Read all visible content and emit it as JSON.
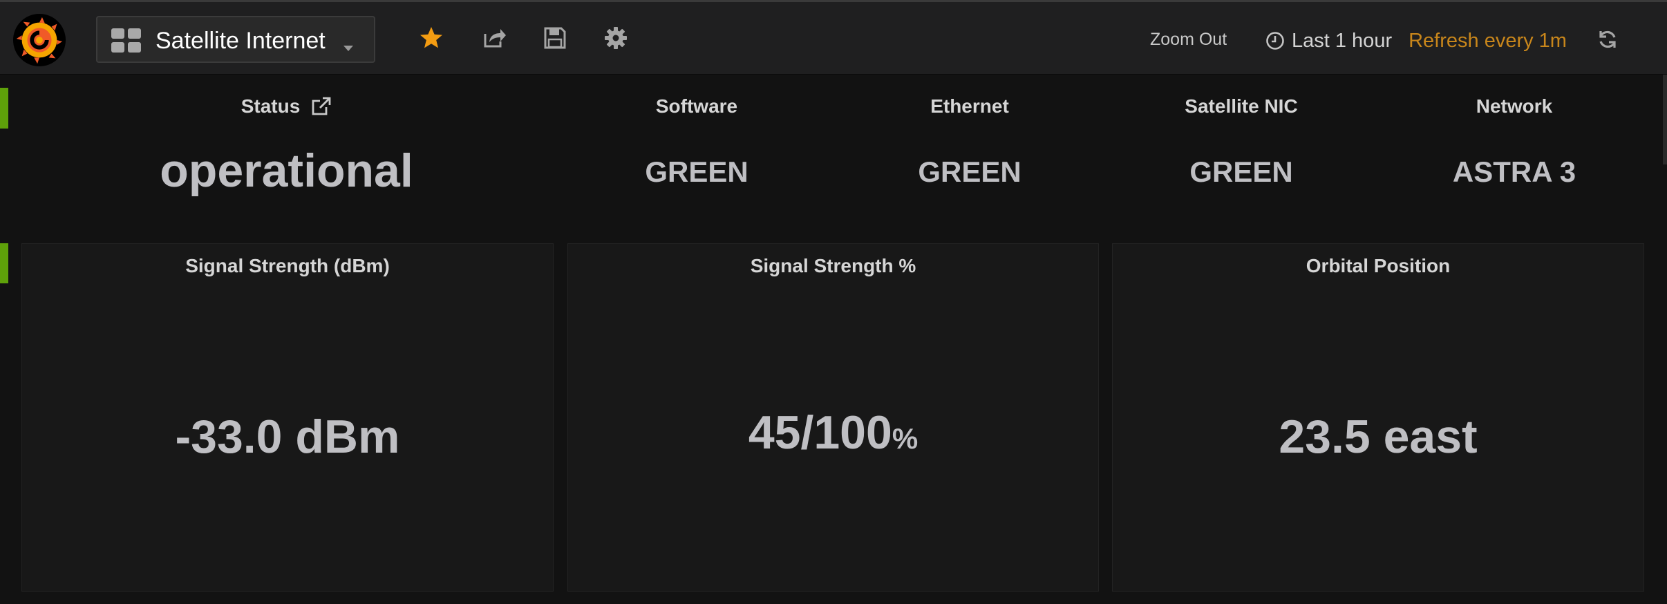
{
  "navbar": {
    "logo_icon": "grafana-logo-icon",
    "dashboard_title": "Satellite Internet",
    "icons": [
      "dashboards-grid-icon",
      "star-icon",
      "share-icon",
      "save-icon",
      "gear-icon",
      "clock-icon",
      "refresh-icon"
    ],
    "zoom_out_label": "Zoom Out",
    "time_range": "Last 1 hour",
    "refresh_label": "Refresh every 1m",
    "star_color": "#f39c12",
    "refresh_color": "#c8861b"
  },
  "row1": {
    "marker_color": "#5ea10a",
    "status": {
      "title": "Status",
      "value": "operational",
      "link_icon": "external-link-icon"
    },
    "software": {
      "title": "Software",
      "value": "GREEN"
    },
    "ethernet": {
      "title": "Ethernet",
      "value": "GREEN"
    },
    "satellite_nic": {
      "title": "Satellite NIC",
      "value": "GREEN"
    },
    "network": {
      "title": "Network",
      "value": "ASTRA 3"
    }
  },
  "row2": {
    "signal_dbm": {
      "title": "Signal Strength (dBm)",
      "value": "-33.0 dBm"
    },
    "signal_pct": {
      "title": "Signal Strength %",
      "value": "45/100",
      "unit": "%"
    },
    "orbital": {
      "title": "Orbital Position",
      "value": "23.5 east"
    }
  }
}
